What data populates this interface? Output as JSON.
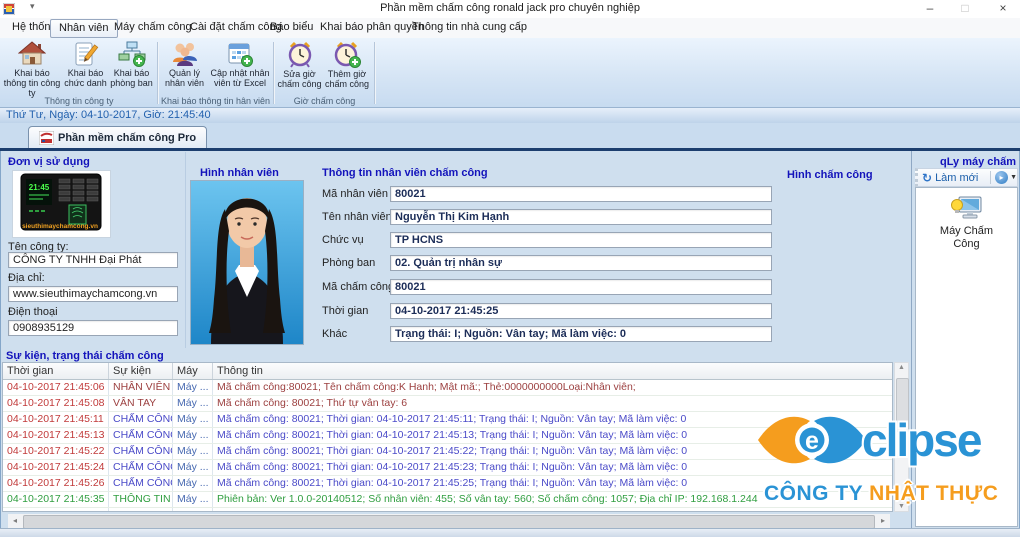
{
  "window": {
    "title": "Phần mềm chấm công ronald jack pro chuyên nghiệp",
    "controls": {
      "minimize": "–",
      "maximize": "□",
      "close": "×",
      "quick_access_caret": "▾"
    }
  },
  "menu": {
    "tabs": [
      "Hệ thống",
      "Nhân viên",
      "Máy chấm công",
      "Cài đặt chấm công",
      "Báo biểu",
      "Khai báo phân quyền",
      "Thông tin nhà cung cấp"
    ],
    "active_tab": "Nhân viên"
  },
  "ribbon": {
    "groups": [
      {
        "caption": "Thông tin công ty",
        "buttons": [
          {
            "label": "Khai báo thông tin công ty",
            "icon": "house-icon"
          },
          {
            "label": "Khai báo chức danh",
            "icon": "notepad-pencil-icon"
          },
          {
            "label": "Khai báo phòng ban",
            "icon": "org-chart-add-icon"
          }
        ]
      },
      {
        "caption": "Khai báo thông tin hân viên",
        "buttons": [
          {
            "label": "Quản lý nhân viên",
            "icon": "people-icon"
          },
          {
            "label": "Cập nhật nhân viên từ Excel",
            "icon": "calendar-add-icon"
          }
        ]
      },
      {
        "caption": "Giờ chấm công",
        "buttons": [
          {
            "label": "Sửa giờ chấm công",
            "icon": "clock-icon"
          },
          {
            "label": "Thêm giờ chấm công",
            "icon": "clock-add-icon"
          }
        ]
      }
    ]
  },
  "datebar": {
    "text": "Thứ Tư, Ngày: 04-10-2017, Giờ: 21:45:40"
  },
  "doc_tab": {
    "label": "Phần mềm chấm công Pro"
  },
  "left_panel": {
    "header": "Đơn vị sử dụng",
    "device_text": "sieuthimaychamcong.vn",
    "device_screen_time": "21:45",
    "fields": [
      {
        "label": "Tên công ty:",
        "value": "CÔNG TY TNHH Đại Phát"
      },
      {
        "label": "Địa chỉ:",
        "value": "www.sieuthimaychamcong.vn"
      },
      {
        "label": "Điện thoại",
        "value": "0908935129"
      }
    ]
  },
  "employee": {
    "photo_header": "Hình nhân viên",
    "info_header": "Thông tin nhân viên chấm công",
    "fields": [
      {
        "label": "Mã nhân viên",
        "value": "80021"
      },
      {
        "label": "Tên nhân viên",
        "value": "Nguyễn Thị Kim Hạnh"
      },
      {
        "label": "Chức vụ",
        "value": "TP HCNS"
      },
      {
        "label": "Phòng ban",
        "value": "02. Quản trị nhân sự"
      },
      {
        "label": "Mã chấm công",
        "value": "80021"
      },
      {
        "label": "Thời gian",
        "value": "04-10-2017 21:45:25"
      },
      {
        "label": "Khác",
        "value": "Trạng thái: I; Nguồn: Vân tay; Mã làm việc: 0"
      }
    ]
  },
  "hinh_cham_cong_header": "Hình chấm công",
  "right_panel": {
    "header": "qLy máy chấm công",
    "refresh_label": "Làm mới",
    "item_label": "Máy Chấm Công"
  },
  "events": {
    "header": "Sự kiện, trạng thái chấm công",
    "columns": [
      "Thời gian",
      "Sự kiện",
      "Máy",
      "Thông tin"
    ],
    "rows": [
      {
        "time": "04-10-2017 21:45:06",
        "event": "NHÂN VIÊN",
        "may": "Máy ...",
        "info": "Mã chấm công:80021; Tên chấm công:K Hanh; Mật mã:; Thẻ:0000000000Loại:Nhân viên;"
      },
      {
        "time": "04-10-2017 21:45:08",
        "event": "VÂN TAY",
        "may": "Máy ...",
        "info": "Mã chấm công: 80021; Thứ tự vân tay: 6"
      },
      {
        "time": "04-10-2017 21:45:11",
        "event": "CHẤM CÔNG",
        "may": "Máy ...",
        "info": "Mã chấm công: 80021; Thời gian: 04-10-2017 21:45:11; Trạng thái: I; Nguồn: Vân tay; Mã làm việc: 0"
      },
      {
        "time": "04-10-2017 21:45:13",
        "event": "CHẤM CÔNG",
        "may": "Máy ...",
        "info": "Mã chấm công: 80021; Thời gian: 04-10-2017 21:45:13; Trạng thái: I; Nguồn: Vân tay; Mã làm việc: 0"
      },
      {
        "time": "04-10-2017 21:45:22",
        "event": "CHẤM CÔNG",
        "may": "Máy ...",
        "info": "Mã chấm công: 80021; Thời gian: 04-10-2017 21:45:22; Trạng thái: I; Nguồn: Vân tay; Mã làm việc: 0"
      },
      {
        "time": "04-10-2017 21:45:24",
        "event": "CHẤM CÔNG",
        "may": "Máy ...",
        "info": "Mã chấm công: 80021; Thời gian: 04-10-2017 21:45:23; Trạng thái: I; Nguồn: Vân tay; Mã làm việc: 0"
      },
      {
        "time": "04-10-2017 21:45:26",
        "event": "CHẤM CÔNG",
        "may": "Máy ...",
        "info": "Mã chấm công: 80021; Thời gian: 04-10-2017 21:45:25; Trạng thái: I; Nguồn: Vân tay; Mã làm việc: 0"
      },
      {
        "time": "04-10-2017 21:45:35",
        "event": "THÔNG TIN",
        "may": "Máy ...",
        "info": "Phiên bản: Ver 1.0.0-20140512; Số nhân viên: 455; Số vân tay: 560; Số chấm công: 1057; Địa chỉ IP: 192.168.1.244"
      }
    ]
  },
  "palette": {
    "red": "#c13a3a",
    "maroon": "#9c4040",
    "blue": "#4a4ac8",
    "green": "#2f9e3f",
    "may_col": "#4668b0",
    "wm_blue": "#2a93d5",
    "wm_orange": "#f59d1e"
  },
  "icons": {
    "refresh": "↻",
    "dropdown_play": "▸",
    "dropdown_caret": "▼",
    "scroll_up": "▲",
    "scroll_down": "▼",
    "scroll_left": "◂",
    "scroll_right": "▸"
  },
  "watermark": {
    "brand": "clipse",
    "company_blue": "CÔNG TY ",
    "company_orange": "NHẬT THỰC"
  }
}
